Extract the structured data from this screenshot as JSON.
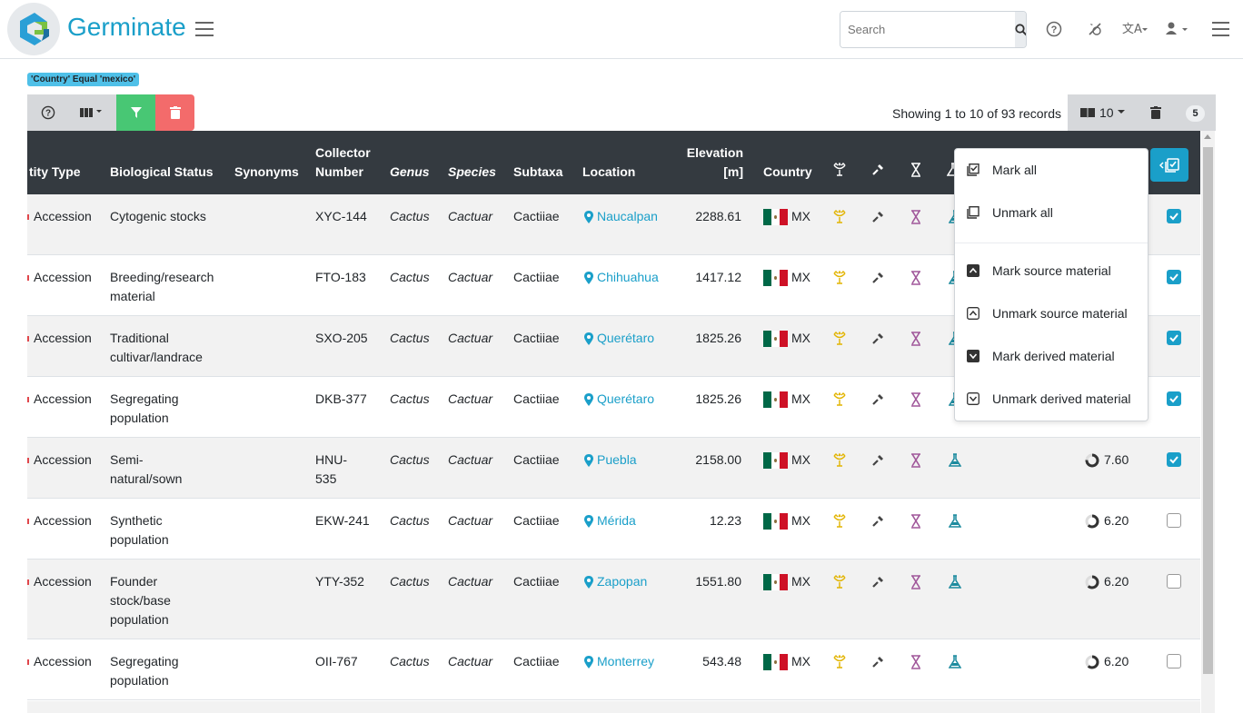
{
  "app": {
    "brand": "Germinate"
  },
  "search": {
    "placeholder": "Search"
  },
  "filter_badge": "'Country' Equal 'mexico'",
  "pagination": {
    "showing": "Showing 1 to 10 of 93 records",
    "page_size": "10",
    "marked_count": "5"
  },
  "colors": {
    "accent": "#1a9fc9",
    "header": "#343a40",
    "green": "#48c774",
    "red": "#f36b6b",
    "badge": "#4fc0e8"
  },
  "table": {
    "headers": {
      "entity_type": "tity Type",
      "bio_status": "Biological Status",
      "synonyms": "Synonyms",
      "collector_1": "Collector",
      "collector_2": "Number",
      "genus": "Genus",
      "species": "Species",
      "subtaxa": "Subtaxa",
      "location": "Location",
      "elevation_1": "Elevation",
      "elevation_2": "[m]",
      "country": "Country"
    },
    "rows": [
      {
        "entity": "Accession",
        "status": [
          "Cytogenic stocks"
        ],
        "collector": [
          "XYC-144"
        ],
        "genus": "Cactus",
        "species": "Cactuar",
        "subtaxa": "Cactiiae",
        "location": "Naucalpan",
        "elevation": "2288.61",
        "country": "MX",
        "pdci": "",
        "marked": true
      },
      {
        "entity": "Accession",
        "status": [
          "Breeding/research",
          "material"
        ],
        "collector": [
          "FTO-183"
        ],
        "genus": "Cactus",
        "species": "Cactuar",
        "subtaxa": "Cactiiae",
        "location": "Chihuahua",
        "elevation": "1417.12",
        "country": "MX",
        "pdci": "",
        "marked": true
      },
      {
        "entity": "Accession",
        "status": [
          "Traditional",
          "cultivar/landrace"
        ],
        "collector": [
          "SXO-205"
        ],
        "genus": "Cactus",
        "species": "Cactuar",
        "subtaxa": "Cactiiae",
        "location": "Querétaro",
        "elevation": "1825.26",
        "country": "MX",
        "pdci": "",
        "marked": true
      },
      {
        "entity": "Accession",
        "status": [
          "Segregating",
          "population"
        ],
        "collector": [
          "DKB-377"
        ],
        "genus": "Cactus",
        "species": "Cactuar",
        "subtaxa": "Cactiiae",
        "location": "Querétaro",
        "elevation": "1825.26",
        "country": "MX",
        "pdci": "",
        "marked": true
      },
      {
        "entity": "Accession",
        "status": [
          "Semi-",
          "natural/sown"
        ],
        "collector": [
          "HNU-",
          "535"
        ],
        "genus": "Cactus",
        "species": "Cactuar",
        "subtaxa": "Cactiiae",
        "location": "Puebla",
        "elevation": "2158.00",
        "country": "MX",
        "pdci": "7.60",
        "marked": true
      },
      {
        "entity": "Accession",
        "status": [
          "Synthetic",
          "population"
        ],
        "collector": [
          "EKW-241"
        ],
        "genus": "Cactus",
        "species": "Cactuar",
        "subtaxa": "Cactiiae",
        "location": "Mérida",
        "elevation": "12.23",
        "country": "MX",
        "pdci": "6.20",
        "marked": false
      },
      {
        "entity": "Accession",
        "status": [
          "Founder",
          "stock/base",
          "population"
        ],
        "collector": [
          "YTY-352"
        ],
        "genus": "Cactus",
        "species": "Cactuar",
        "subtaxa": "Cactiiae",
        "location": "Zapopan",
        "elevation": "1551.80",
        "country": "MX",
        "pdci": "6.20",
        "marked": false
      },
      {
        "entity": "Accession",
        "status": [
          "Segregating",
          "population"
        ],
        "collector": [
          "OII-767"
        ],
        "genus": "Cactus",
        "species": "Cactuar",
        "subtaxa": "Cactiiae",
        "location": "Monterrey",
        "elevation": "543.48",
        "country": "MX",
        "pdci": "6.20",
        "marked": false
      }
    ]
  },
  "mark_menu": {
    "items": [
      "Mark all",
      "Unmark all",
      "Mark source material",
      "Unmark source material",
      "Mark derived material",
      "Unmark derived material"
    ]
  }
}
